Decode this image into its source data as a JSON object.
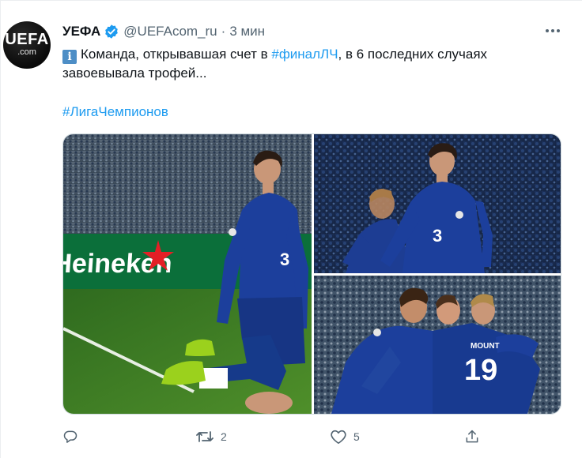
{
  "tweet": {
    "avatar": {
      "line1": "UEFA",
      "line2": ".com"
    },
    "display_name": "УЕФА",
    "handle": "@UEFAcom_ru",
    "separator": "·",
    "time": "3 мин",
    "text_part1": "Команда, открывавшая счет в ",
    "text_hashtag": "#финалЛЧ",
    "text_part2": ", в 6 последних случаях",
    "text_line2": "завоевывала трофей...",
    "info_glyph": "i",
    "hashtag": "#ЛигаЧемпионов",
    "photos": [
      {
        "ad_text": "Heineken",
        "shirt_number": "3"
      },
      {
        "shirt_number": "3"
      },
      {
        "shirt_name": "MOUNT",
        "shirt_number": "19"
      }
    ]
  },
  "actions": {
    "reply_count": "",
    "retweet_count": "2",
    "like_count": "5"
  },
  "icons": {
    "verified": "verified-badge-icon",
    "more": "more-dots-icon",
    "reply": "reply-icon",
    "retweet": "retweet-icon",
    "like": "heart-icon",
    "share": "share-icon"
  },
  "colors": {
    "accent": "#1d9bf0",
    "muted": "#536471",
    "chelsea_blue": "#1c3f9c"
  }
}
